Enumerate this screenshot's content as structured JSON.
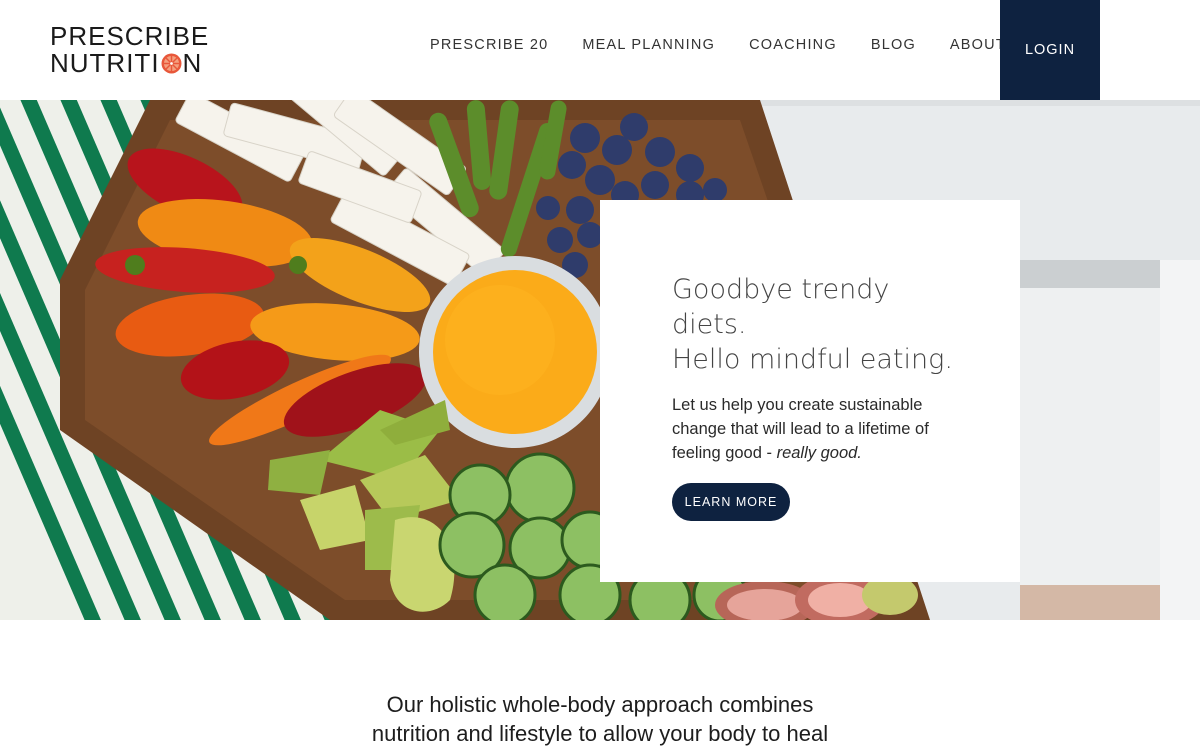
{
  "brand": {
    "line1": "PRESCRIBE",
    "line2_prefix": "NUTRITI",
    "line2_suffix": "N",
    "fruit_icon": "orange-slice-icon",
    "accent_color": "#e8573a"
  },
  "nav": {
    "items": [
      {
        "label": "PRESCRIBE 20"
      },
      {
        "label": "MEAL PLANNING"
      },
      {
        "label": "COACHING"
      },
      {
        "label": "BLOG"
      },
      {
        "label": "ABOUT"
      }
    ],
    "login_label": "LOGIN",
    "login_color": "#0e2240"
  },
  "hero": {
    "title_line1": "Goodbye trendy",
    "title_line2": "diets.",
    "title_line3": "Hello mindful eating.",
    "body_text": "Let us help you create sustainable change that will lead to a lifetime of feeling good - ",
    "body_emphasis": "really good.",
    "cta_label": "LEARN MORE",
    "image": "vegetable-platter-photo"
  },
  "intro": {
    "line1": "Our holistic whole-body approach combines",
    "line2": "nutrition and lifestyle to allow your body to heal"
  }
}
